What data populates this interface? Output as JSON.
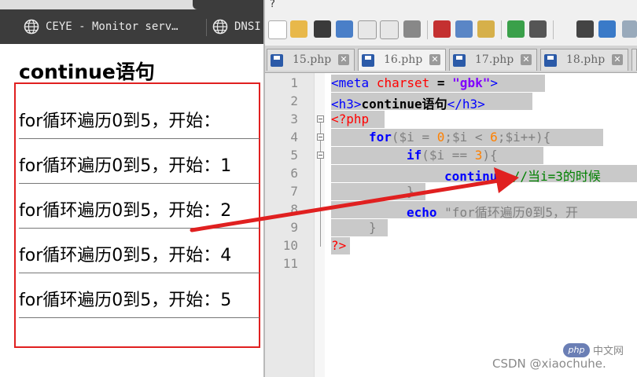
{
  "browser": {
    "tabs": [
      {
        "title": "CEYE - Monitor serv…",
        "icon": "globe-icon"
      },
      {
        "title": "DNSI",
        "icon": "globe-icon"
      }
    ],
    "page": {
      "heading": "continue语句",
      "lines": [
        "for循环遍历0到5，开始：",
        "for循环遍历0到5，开始：1",
        "for循环遍历0到5，开始：2",
        "for循环遍历0到5，开始：4",
        "for循环遍历0到5，开始：5"
      ]
    }
  },
  "editor": {
    "menu": "?",
    "file_tabs": [
      "15.php",
      "16.php",
      "17.php",
      "18.php"
    ],
    "line_numbers": [
      "1",
      "2",
      "3",
      "4",
      "5",
      "6",
      "7",
      "8",
      "9",
      "10",
      "11"
    ],
    "code": {
      "l1": {
        "open": "<meta",
        "attr": "charset",
        "eq": "=",
        "val": "\"gbk\"",
        "close": ">"
      },
      "l2": {
        "open": "<h3>",
        "text": "continue语句",
        "close": "</h3>"
      },
      "l3": "<?php",
      "l4": {
        "kw": "for",
        "p1": "(",
        "v1": "$i",
        "o1": " = ",
        "n1": "0",
        "s1": ";",
        "v2": "$i",
        "o2": " < ",
        "n2": "6",
        "s2": ";",
        "v3": "$i",
        "o3": "++){"
      },
      "l5": {
        "kw": "if",
        "p1": "(",
        "v1": "$i",
        "o1": " == ",
        "n1": "3",
        "p2": "){"
      },
      "l6": {
        "kw": "continue",
        "semi": ";",
        "comment": "//当i=3的时候"
      },
      "l7": "}",
      "l8": {
        "kw": "echo",
        "str": "\"for循环遍历0到5，开"
      },
      "l9": "}",
      "l10": "?>"
    }
  },
  "watermark": {
    "badge": "php",
    "site": "中文网",
    "author": "CSDN @xiaochuhe."
  },
  "colors": {
    "annotation_red": "#e02020",
    "tab_bar": "#3c3c3c",
    "html_tag": "#0000ff",
    "php_delim": "#ff0000",
    "comment": "#008000",
    "selection": "#c9c9c9"
  }
}
